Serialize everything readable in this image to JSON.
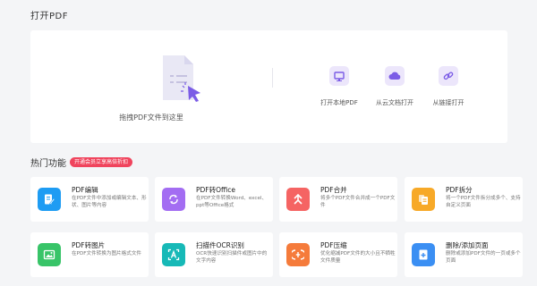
{
  "open_section": {
    "title": "打开PDF",
    "drop_label": "拖拽PDF文件到这里",
    "options": [
      {
        "label": "打开本地PDF",
        "icon": "monitor-icon"
      },
      {
        "label": "从云文档打开",
        "icon": "cloud-icon"
      },
      {
        "label": "从链接打开",
        "icon": "link-icon"
      }
    ]
  },
  "hot_section": {
    "title": "热门功能",
    "badge": "开通会员立享高倍折扣"
  },
  "features": [
    {
      "title": "PDF编辑",
      "desc": "在PDF文件中添加或编辑文本、形状、图片等内容",
      "icon": "edit-icon",
      "color": "#1e9cf3"
    },
    {
      "title": "PDF转Office",
      "desc": "在PDF文件转换Word、excel、ppt等Office格式",
      "icon": "convert-icon",
      "color": "#a36df2"
    },
    {
      "title": "PDF合并",
      "desc": "将多个PDF文件合并成一个PDF文件",
      "icon": "merge-icon",
      "color": "#f56463"
    },
    {
      "title": "PDF拆分",
      "desc": "将一个PDF文件拆分成多个、支持自定义页面",
      "icon": "split-icon",
      "color": "#f7a928"
    },
    {
      "title": "PDF转图片",
      "desc": "在PDF文件转换为图片格式文件",
      "icon": "image-icon",
      "color": "#38c468"
    },
    {
      "title": "扫描件OCR识别",
      "desc": "OCR快速识别扫描件或图片中的文字内容",
      "icon": "ocr-icon",
      "color": "#17b9b7"
    },
    {
      "title": "PDF压缩",
      "desc": "优化缩减PDF文件的大小且不牺牲文件质量",
      "icon": "compress-icon",
      "color": "#f57b3b"
    },
    {
      "title": "删除/添加页面",
      "desc": "删除或添加PDF文件的一页或多个页面",
      "icon": "page-add-icon",
      "color": "#3b8ff3"
    }
  ]
}
